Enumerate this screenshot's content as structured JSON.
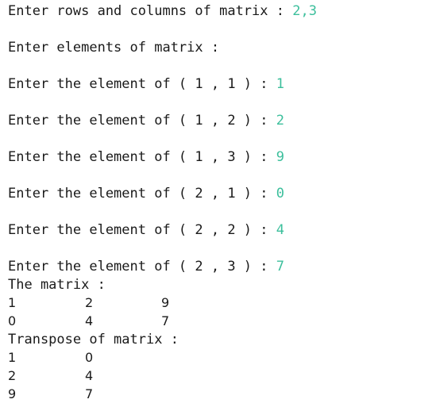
{
  "console": {
    "prompt_dims": "Enter rows and columns of matrix : ",
    "input_dims": "2,3",
    "prompt_elements": "Enter elements of matrix :",
    "element_lines": [
      {
        "prompt": "Enter the element of ( 1 , 1 ) : ",
        "value": "1"
      },
      {
        "prompt": "Enter the element of ( 1 , 2 ) : ",
        "value": "2"
      },
      {
        "prompt": "Enter the element of ( 1 , 3 ) : ",
        "value": "9"
      },
      {
        "prompt": "Enter the element of ( 2 , 1 ) : ",
        "value": "0"
      },
      {
        "prompt": "Enter the element of ( 2 , 2 ) : ",
        "value": "4"
      },
      {
        "prompt": "Enter the element of ( 2 , 3 ) : ",
        "value": "7"
      }
    ],
    "matrix_heading": "The matrix :",
    "matrix_rows": [
      [
        "1",
        "2",
        "9"
      ],
      [
        "0",
        "4",
        "7"
      ]
    ],
    "transpose_heading": "Transpose of matrix :",
    "transpose_rows": [
      [
        "1",
        "0"
      ],
      [
        "2",
        "4"
      ],
      [
        "9",
        "7"
      ]
    ]
  },
  "colors": {
    "text": "#1a1a1a",
    "user_input": "#3cbf9c",
    "background": "#ffffff"
  }
}
